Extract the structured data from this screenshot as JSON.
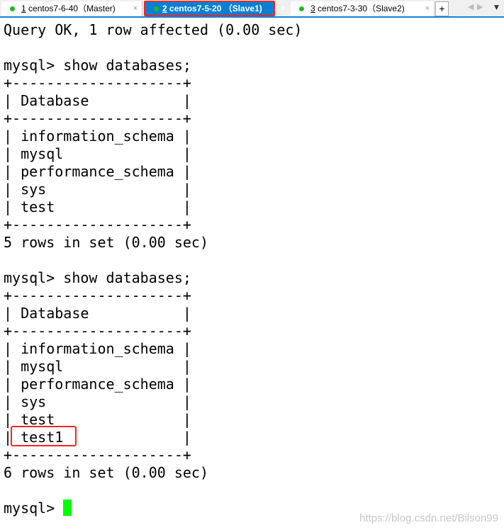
{
  "tabs": [
    {
      "num": "1",
      "label": " centos7-6-40（Master)",
      "active": false
    },
    {
      "num": "2",
      "label": " centos7-5-20 （Slave1)",
      "active": true
    },
    {
      "num": "3",
      "label": " centos7-3-30（Slave2)",
      "active": false
    }
  ],
  "tab_close": "×",
  "new_tab": "+",
  "colors": {
    "accent": "#0a7fd6",
    "highlight": "#f0281e",
    "cursor": "#00ff00",
    "status_dot": "#1db91d"
  },
  "terminal": {
    "lines": [
      "Query OK, 1 row affected (0.00 sec)",
      "",
      "mysql> show databases;",
      "+--------------------+",
      "| Database           |",
      "+--------------------+",
      "| information_schema |",
      "| mysql              |",
      "| performance_schema |",
      "| sys                |",
      "| test               |",
      "+--------------------+",
      "5 rows in set (0.00 sec)",
      "",
      "mysql> show databases;",
      "+--------------------+",
      "| Database           |",
      "+--------------------+",
      "| information_schema |",
      "| mysql              |",
      "| performance_schema |",
      "| sys                |",
      "| test               |",
      "| test1              |",
      "+--------------------+",
      "6 rows in set (0.00 sec)",
      "",
      "mysql> "
    ]
  },
  "watermark": "https://blog.csdn.net/Bilson99"
}
